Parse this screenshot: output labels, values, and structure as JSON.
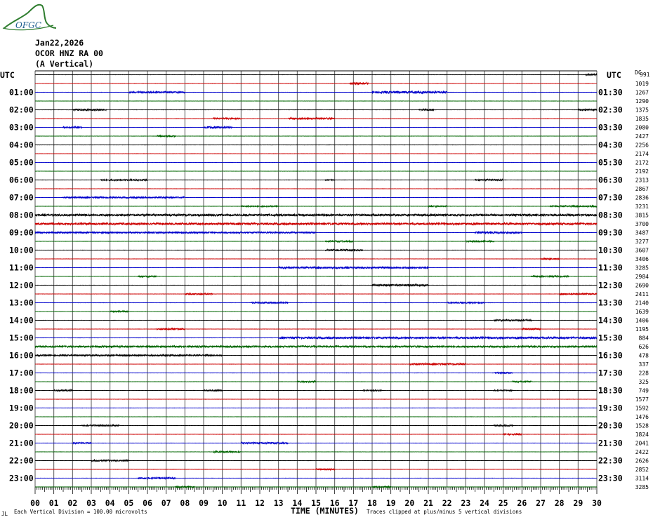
{
  "logo": {
    "name": "ofgc-logo",
    "text": "OFGC",
    "color": "#2e7d2e"
  },
  "header": {
    "date": "Jan22,2026",
    "station": "OCOR HNZ RA 00",
    "orientation": "(A Vertical)"
  },
  "utc_left_label": "UTC",
  "utc_right_label": "UTC",
  "dc_label": "DC",
  "top_right_value": "991",
  "footer": {
    "vertical_division": "Each Vertical Division =  100.00 microvolts",
    "x_axis_title": "TIME (MINUTES)",
    "clip_note": "Traces clipped at plus/minus 5 vertical divisions",
    "corner": "JL"
  },
  "chart_data": {
    "type": "line",
    "title": "",
    "xlabel": "TIME (MINUTES)",
    "ylabel": "UTC",
    "xlim": [
      0,
      30
    ],
    "x_ticks": [
      "00",
      "01",
      "02",
      "03",
      "04",
      "05",
      "06",
      "07",
      "08",
      "09",
      "10",
      "11",
      "12",
      "13",
      "14",
      "15",
      "16",
      "17",
      "18",
      "19",
      "20",
      "21",
      "22",
      "23",
      "24",
      "25",
      "26",
      "27",
      "28",
      "29",
      "30"
    ],
    "grid": true,
    "trace_colors": [
      "#000000",
      "#cc0000",
      "#0000cc",
      "#006600"
    ],
    "hour_labels_left": [
      "01:00",
      "02:00",
      "03:00",
      "04:00",
      "05:00",
      "06:00",
      "07:00",
      "08:00",
      "09:00",
      "10:00",
      "11:00",
      "12:00",
      "13:00",
      "14:00",
      "15:00",
      "16:00",
      "17:00",
      "18:00",
      "19:00",
      "20:00",
      "21:00",
      "22:00",
      "23:00"
    ],
    "hour_labels_right": [
      "01:30",
      "02:30",
      "03:30",
      "04:30",
      "05:30",
      "06:30",
      "07:30",
      "08:30",
      "09:30",
      "10:30",
      "11:30",
      "12:30",
      "13:30",
      "14:30",
      "15:30",
      "16:30",
      "17:30",
      "18:30",
      "19:30",
      "20:30",
      "21:30",
      "22:30",
      "23:30"
    ],
    "dc_offsets": [
      "1019",
      "1267",
      "1290",
      "1375",
      "1835",
      "2080",
      "2427",
      "2256",
      "2174",
      "2172",
      "2192",
      "2313",
      "2867",
      "2836",
      "3231",
      "3815",
      "3700",
      "3487",
      "3277",
      "3607",
      "3406",
      "3285",
      "2984",
      "2690",
      "2411",
      "2140",
      "1639",
      "1406",
      "1195",
      "884",
      "626",
      "478",
      "337",
      "228",
      "325",
      "749",
      "1577",
      "1592",
      "1476",
      "1528",
      "1824",
      "2041",
      "2422",
      "2626",
      "2852",
      "3114",
      "3285"
    ],
    "activity": [
      {
        "trace": 0,
        "start": 29.4,
        "end": 30,
        "amp": 1.2
      },
      {
        "trace": 1,
        "start": 16.8,
        "end": 17.8,
        "amp": 1.5
      },
      {
        "trace": 2,
        "start": 5.0,
        "end": 8.0,
        "amp": 1.2
      },
      {
        "trace": 2,
        "start": 18.0,
        "end": 22.0,
        "amp": 1.5
      },
      {
        "trace": 4,
        "start": 2.0,
        "end": 3.8,
        "amp": 1.2
      },
      {
        "trace": 4,
        "start": 20.5,
        "end": 21.3,
        "amp": 1.0
      },
      {
        "trace": 4,
        "start": 29.0,
        "end": 30.0,
        "amp": 1.0
      },
      {
        "trace": 5,
        "start": 9.5,
        "end": 11.0,
        "amp": 1.0
      },
      {
        "trace": 5,
        "start": 13.5,
        "end": 16.0,
        "amp": 1.2
      },
      {
        "trace": 6,
        "start": 1.5,
        "end": 2.5,
        "amp": 1.0
      },
      {
        "trace": 6,
        "start": 9.0,
        "end": 10.5,
        "amp": 1.5
      },
      {
        "trace": 7,
        "start": 6.5,
        "end": 7.5,
        "amp": 1.2
      },
      {
        "trace": 12,
        "start": 3.5,
        "end": 6.0,
        "amp": 1.0
      },
      {
        "trace": 12,
        "start": 15.5,
        "end": 16.0,
        "amp": 0.8
      },
      {
        "trace": 12,
        "start": 23.5,
        "end": 25.0,
        "amp": 1.0
      },
      {
        "trace": 14,
        "start": 1.5,
        "end": 8.0,
        "amp": 1.0
      },
      {
        "trace": 15,
        "start": 11.0,
        "end": 13.0,
        "amp": 0.8
      },
      {
        "trace": 15,
        "start": 21.0,
        "end": 22.0,
        "amp": 0.8
      },
      {
        "trace": 15,
        "start": 27.5,
        "end": 30.0,
        "amp": 1.0
      },
      {
        "trace": 16,
        "start": 0,
        "end": 30,
        "amp": 1.4
      },
      {
        "trace": 17,
        "start": 0,
        "end": 30,
        "amp": 1.4
      },
      {
        "trace": 18,
        "start": 0,
        "end": 15.0,
        "amp": 1.0
      },
      {
        "trace": 18,
        "start": 23.5,
        "end": 26.0,
        "amp": 1.3
      },
      {
        "trace": 19,
        "start": 15.5,
        "end": 17.0,
        "amp": 1.0
      },
      {
        "trace": 19,
        "start": 23.0,
        "end": 24.5,
        "amp": 1.0
      },
      {
        "trace": 20,
        "start": 15.5,
        "end": 17.5,
        "amp": 1.2
      },
      {
        "trace": 21,
        "start": 27.0,
        "end": 28.0,
        "amp": 1.0
      },
      {
        "trace": 22,
        "start": 13.0,
        "end": 21.0,
        "amp": 1.2
      },
      {
        "trace": 23,
        "start": 5.5,
        "end": 6.5,
        "amp": 1.0
      },
      {
        "trace": 23,
        "start": 26.5,
        "end": 28.5,
        "amp": 1.0
      },
      {
        "trace": 24,
        "start": 18.0,
        "end": 21.0,
        "amp": 1.3
      },
      {
        "trace": 25,
        "start": 8.0,
        "end": 9.5,
        "amp": 1.0
      },
      {
        "trace": 25,
        "start": 28.0,
        "end": 30.0,
        "amp": 1.0
      },
      {
        "trace": 26,
        "start": 11.5,
        "end": 13.5,
        "amp": 1.0
      },
      {
        "trace": 26,
        "start": 22.0,
        "end": 24.0,
        "amp": 1.0
      },
      {
        "trace": 27,
        "start": 4.0,
        "end": 5.0,
        "amp": 1.0
      },
      {
        "trace": 28,
        "start": 24.5,
        "end": 26.5,
        "amp": 1.0
      },
      {
        "trace": 29,
        "start": 6.5,
        "end": 8.0,
        "amp": 1.2
      },
      {
        "trace": 29,
        "start": 26.0,
        "end": 27.0,
        "amp": 1.0
      },
      {
        "trace": 30,
        "start": 13.0,
        "end": 30.0,
        "amp": 1.3
      },
      {
        "trace": 31,
        "start": 0,
        "end": 30,
        "amp": 1.2
      },
      {
        "trace": 32,
        "start": 0,
        "end": 10.0,
        "amp": 1.0
      },
      {
        "trace": 33,
        "start": 20.0,
        "end": 23.0,
        "amp": 1.2
      },
      {
        "trace": 34,
        "start": 24.5,
        "end": 25.5,
        "amp": 1.0
      },
      {
        "trace": 35,
        "start": 14.0,
        "end": 15.0,
        "amp": 1.0
      },
      {
        "trace": 35,
        "start": 25.5,
        "end": 26.5,
        "amp": 1.0
      },
      {
        "trace": 36,
        "start": 1.0,
        "end": 2.0,
        "amp": 1.0
      },
      {
        "trace": 36,
        "start": 9.0,
        "end": 10.0,
        "amp": 0.8
      },
      {
        "trace": 36,
        "start": 17.5,
        "end": 18.5,
        "amp": 0.8
      },
      {
        "trace": 36,
        "start": 24.5,
        "end": 25.5,
        "amp": 0.8
      },
      {
        "trace": 40,
        "start": 2.5,
        "end": 4.5,
        "amp": 1.0
      },
      {
        "trace": 40,
        "start": 24.5,
        "end": 25.5,
        "amp": 1.0
      },
      {
        "trace": 41,
        "start": 25.0,
        "end": 26.0,
        "amp": 1.0
      },
      {
        "trace": 42,
        "start": 2.0,
        "end": 3.0,
        "amp": 1.0
      },
      {
        "trace": 42,
        "start": 11.0,
        "end": 13.5,
        "amp": 1.2
      },
      {
        "trace": 43,
        "start": 9.5,
        "end": 11.0,
        "amp": 1.0
      },
      {
        "trace": 44,
        "start": 3.0,
        "end": 5.0,
        "amp": 1.0
      },
      {
        "trace": 45,
        "start": 15.0,
        "end": 16.0,
        "amp": 1.0
      },
      {
        "trace": 46,
        "start": 5.5,
        "end": 7.5,
        "amp": 1.2
      },
      {
        "trace": 47,
        "start": 7.5,
        "end": 8.5,
        "amp": 1.0
      },
      {
        "trace": 47,
        "start": 18.0,
        "end": 19.0,
        "amp": 1.0
      }
    ]
  }
}
